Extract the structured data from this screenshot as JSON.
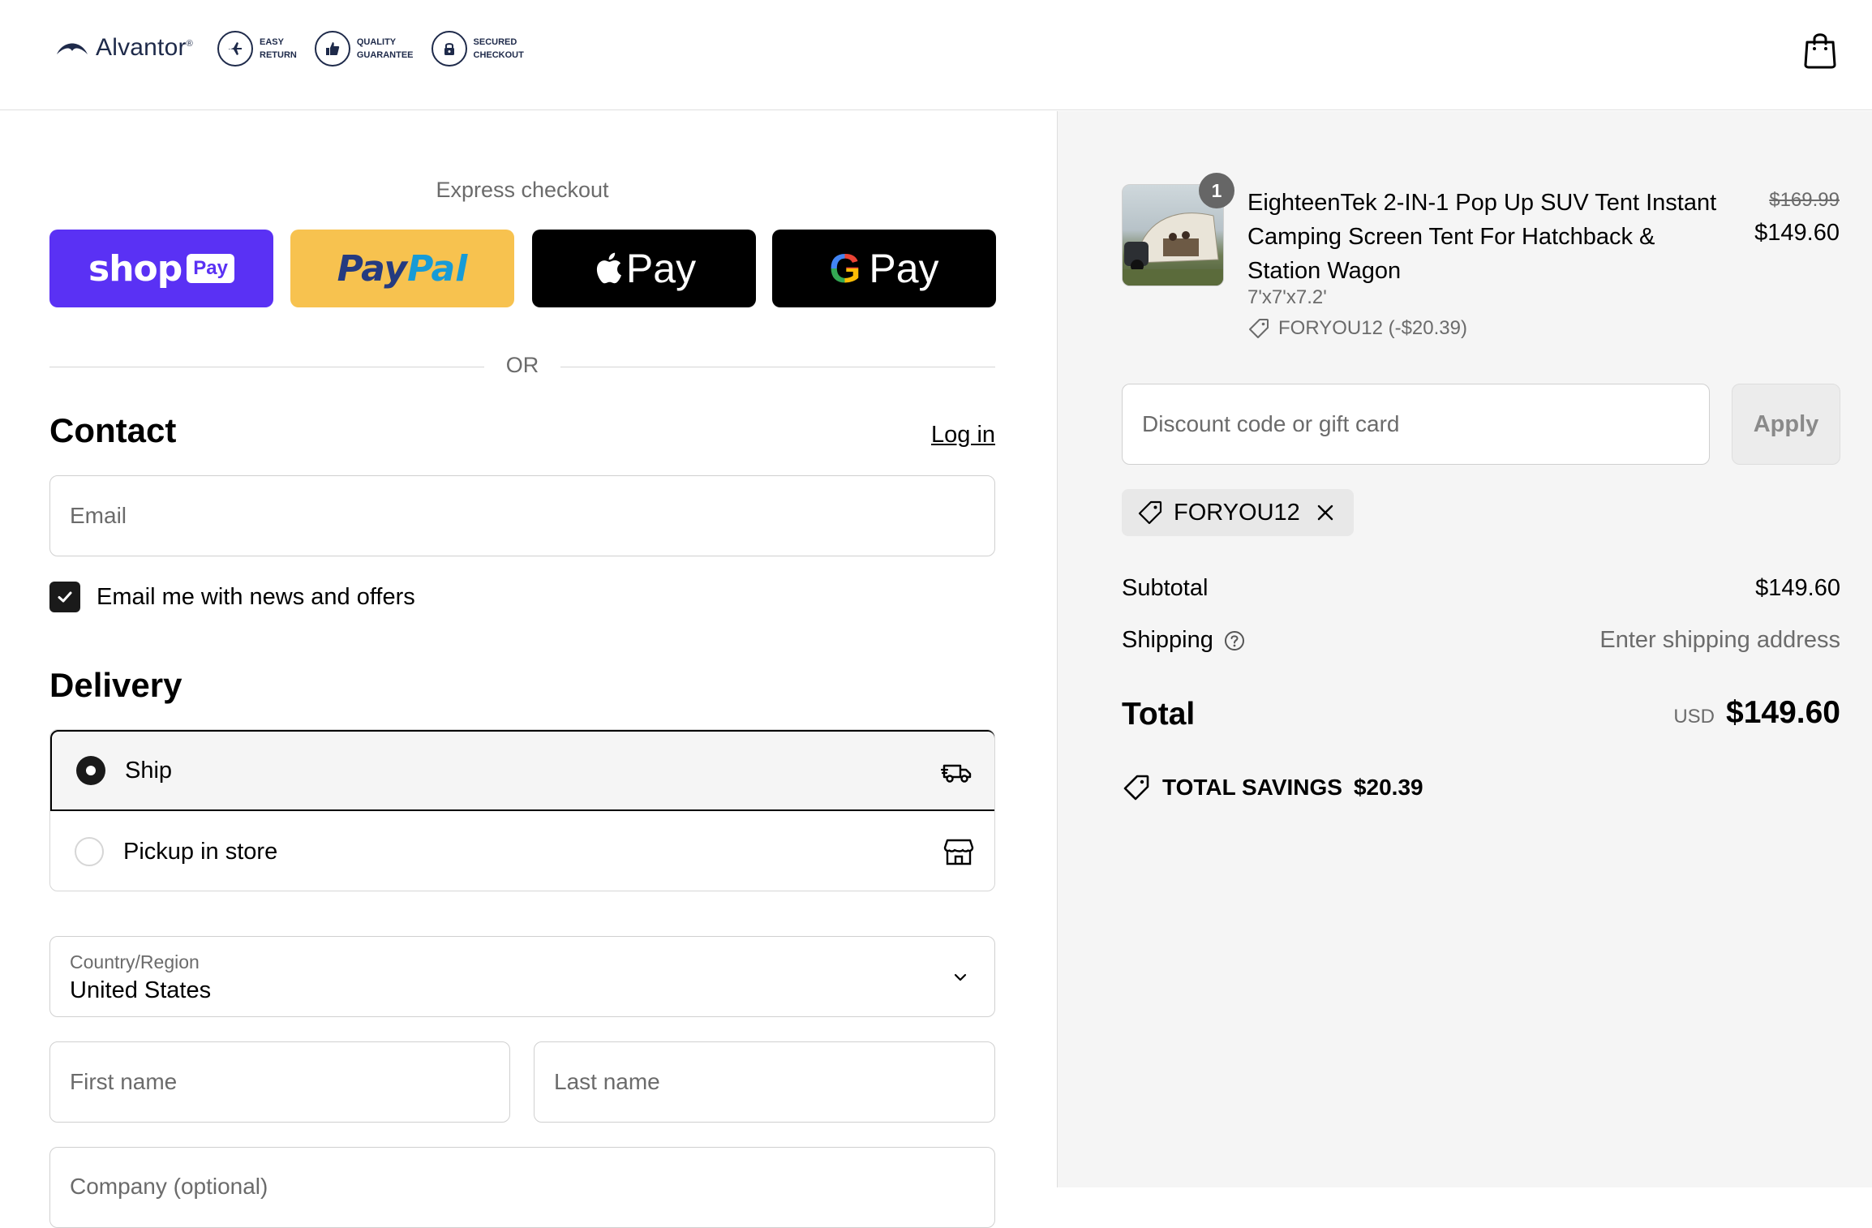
{
  "header": {
    "brand": "Alvantor",
    "brand_mark": "®",
    "badges": [
      {
        "icon": "plane-icon",
        "line1": "EASY",
        "line2": "RETURN"
      },
      {
        "icon": "thumbs-up-icon",
        "line1": "QUALITY",
        "line2": "GUARANTEE"
      },
      {
        "icon": "lock-icon",
        "line1": "SECURED",
        "line2": "CHECKOUT"
      }
    ],
    "cart_icon": "shopping-bag-icon"
  },
  "express": {
    "title": "Express checkout",
    "shop_pay": {
      "word": "shop",
      "tag": "Pay"
    },
    "paypal": {
      "part1": "Pay",
      "part2": "Pal"
    },
    "apple_pay": "Pay",
    "google_pay": {
      "g": "G",
      "word": "Pay"
    },
    "or": "OR"
  },
  "contact": {
    "title": "Contact",
    "login": "Log in",
    "email_placeholder": "Email",
    "newsletter_label": "Email me with news and offers",
    "newsletter_checked": true
  },
  "delivery": {
    "title": "Delivery",
    "options": [
      {
        "label": "Ship",
        "selected": true,
        "icon": "truck-icon"
      },
      {
        "label": "Pickup in store",
        "selected": false,
        "icon": "store-icon"
      }
    ],
    "country_label": "Country/Region",
    "country_value": "United States",
    "first_name_placeholder": "First name",
    "last_name_placeholder": "Last name",
    "company_placeholder": "Company (optional)"
  },
  "order": {
    "quantity": "1",
    "product_title": "EighteenTek 2-IN-1 Pop Up SUV Tent Instant Camping Screen Tent For Hatchback & Station Wagon",
    "variant": "7'x7'x7.2'",
    "discount_line": "FORYOU12 (-$20.39)",
    "price_original": "$169.99",
    "price_current": "$149.60",
    "discount_placeholder": "Discount code or gift card",
    "apply_label": "Apply",
    "applied_code": "FORYOU12",
    "subtotal_label": "Subtotal",
    "subtotal_value": "$149.60",
    "shipping_label": "Shipping",
    "shipping_value": "Enter shipping address",
    "total_label": "Total",
    "currency": "USD",
    "total_value": "$149.60",
    "savings_label": "TOTAL SAVINGS",
    "savings_value": "$20.39"
  },
  "colors": {
    "shop_pay": "#5a31f4",
    "paypal": "#f7c24f",
    "brand_navy": "#1e2a4a",
    "summary_bg": "#f5f5f5"
  }
}
